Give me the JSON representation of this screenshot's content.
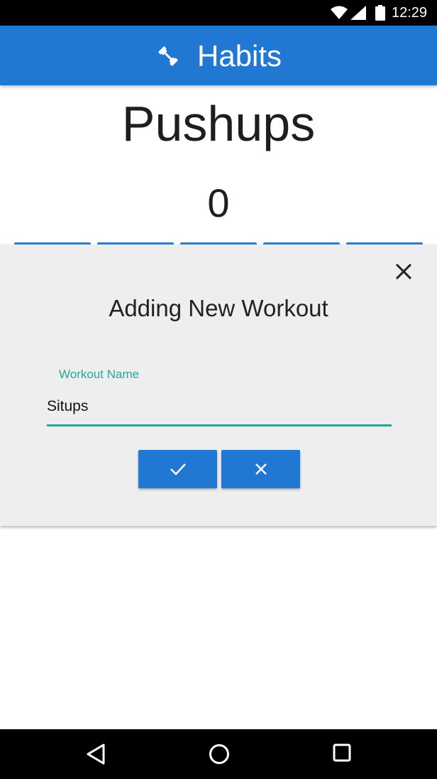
{
  "status_bar": {
    "time": "12:29",
    "icons": [
      "wifi-icon",
      "signal-icon",
      "battery-icon"
    ]
  },
  "app_bar": {
    "title": "Habits",
    "logo_icon": "dumbbell-icon",
    "background_color": "#2178d2"
  },
  "workout": {
    "name": "Pushups",
    "count": "0"
  },
  "dialog": {
    "title": "Adding New Workout",
    "close_icon": "close-icon",
    "field": {
      "label": "Workout Name",
      "value": "Situps",
      "accent_color": "#26a69a"
    },
    "buttons": {
      "confirm_icon": "check-icon",
      "cancel_icon": "close-icon"
    }
  },
  "nav_bar": {
    "icons": [
      "back-icon",
      "home-icon",
      "recents-icon"
    ]
  }
}
